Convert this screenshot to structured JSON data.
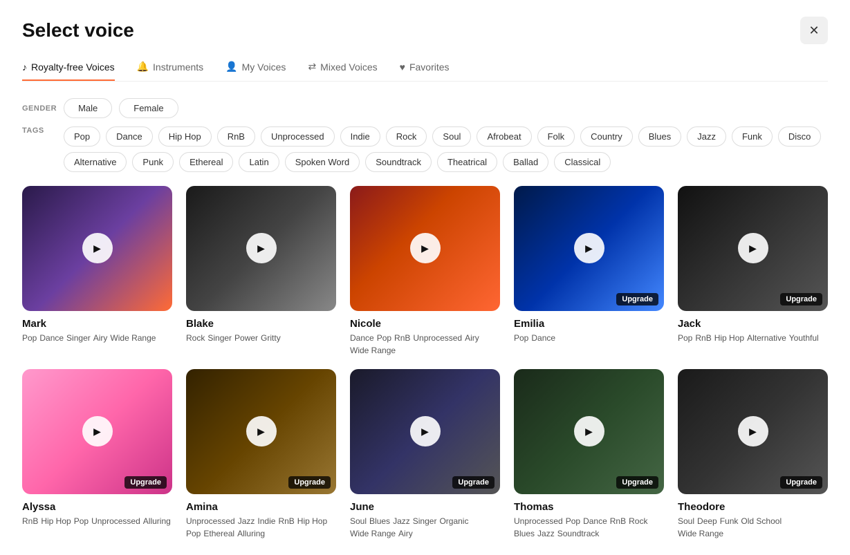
{
  "title": "Select voice",
  "close_label": "✕",
  "tabs": [
    {
      "id": "royalty-free",
      "label": "Royalty-free Voices",
      "icon": "♪",
      "active": true
    },
    {
      "id": "instruments",
      "label": "Instruments",
      "icon": "🔔",
      "active": false
    },
    {
      "id": "my-voices",
      "label": "My Voices",
      "icon": "👤",
      "active": false
    },
    {
      "id": "mixed-voices",
      "label": "Mixed Voices",
      "icon": "⇄",
      "active": false
    },
    {
      "id": "favorites",
      "label": "Favorites",
      "icon": "♥",
      "active": false
    }
  ],
  "gender_label": "GENDER",
  "gender_options": [
    "Male",
    "Female"
  ],
  "tags_label": "TAGS",
  "tags": [
    "Pop",
    "Dance",
    "Hip Hop",
    "RnB",
    "Unprocessed",
    "Indie",
    "Rock",
    "Soul",
    "Afrobeat",
    "Folk",
    "Country",
    "Blues",
    "Jazz",
    "Funk",
    "Disco",
    "Alternative",
    "Punk",
    "Ethereal",
    "Latin",
    "Spoken Word",
    "Soundtrack",
    "Theatrical",
    "Ballad",
    "Classical"
  ],
  "voices": [
    {
      "id": "mark",
      "name": "Mark",
      "thumb_class": "thumb-mark",
      "upgrade": false,
      "tags": [
        "Pop",
        "Dance",
        "Singer",
        "Airy",
        "Wide Range"
      ]
    },
    {
      "id": "blake",
      "name": "Blake",
      "thumb_class": "thumb-blake",
      "upgrade": false,
      "tags": [
        "Rock",
        "Singer",
        "Power",
        "Gritty"
      ]
    },
    {
      "id": "nicole",
      "name": "Nicole",
      "thumb_class": "thumb-nicole",
      "upgrade": false,
      "tags": [
        "Dance",
        "Pop",
        "RnB",
        "Unprocessed",
        "Airy",
        "Wide Range"
      ]
    },
    {
      "id": "emilia",
      "name": "Emilia",
      "thumb_class": "thumb-emilia",
      "upgrade": true,
      "tags": [
        "Pop",
        "Dance"
      ]
    },
    {
      "id": "jack",
      "name": "Jack",
      "thumb_class": "thumb-jack",
      "upgrade": true,
      "tags": [
        "Pop",
        "RnB",
        "Hip Hop",
        "Alternative",
        "Youthful"
      ]
    },
    {
      "id": "alyssa",
      "name": "Alyssa",
      "thumb_class": "thumb-alyssa",
      "upgrade": true,
      "tags": [
        "RnB",
        "Hip Hop",
        "Pop",
        "Unprocessed",
        "Alluring"
      ]
    },
    {
      "id": "amina",
      "name": "Amina",
      "thumb_class": "thumb-amina",
      "upgrade": true,
      "tags": [
        "Unprocessed",
        "Jazz",
        "Indie",
        "RnB",
        "Hip Hop",
        "Pop",
        "Ethereal",
        "Alluring"
      ]
    },
    {
      "id": "june",
      "name": "June",
      "thumb_class": "thumb-june",
      "upgrade": true,
      "tags": [
        "Soul",
        "Blues",
        "Jazz",
        "Singer",
        "Organic",
        "Wide Range",
        "Airy"
      ]
    },
    {
      "id": "thomas",
      "name": "Thomas",
      "thumb_class": "thumb-thomas",
      "upgrade": true,
      "tags": [
        "Unprocessed",
        "Pop",
        "Dance",
        "RnB",
        "Rock",
        "Blues",
        "Jazz",
        "Soundtrack"
      ]
    },
    {
      "id": "theodore",
      "name": "Theodore",
      "thumb_class": "thumb-theodore",
      "upgrade": true,
      "tags": [
        "Soul",
        "Deep",
        "Funk",
        "Old School",
        "Wide Range"
      ]
    }
  ],
  "upgrade_label": "Upgrade",
  "play_icon": "▶"
}
